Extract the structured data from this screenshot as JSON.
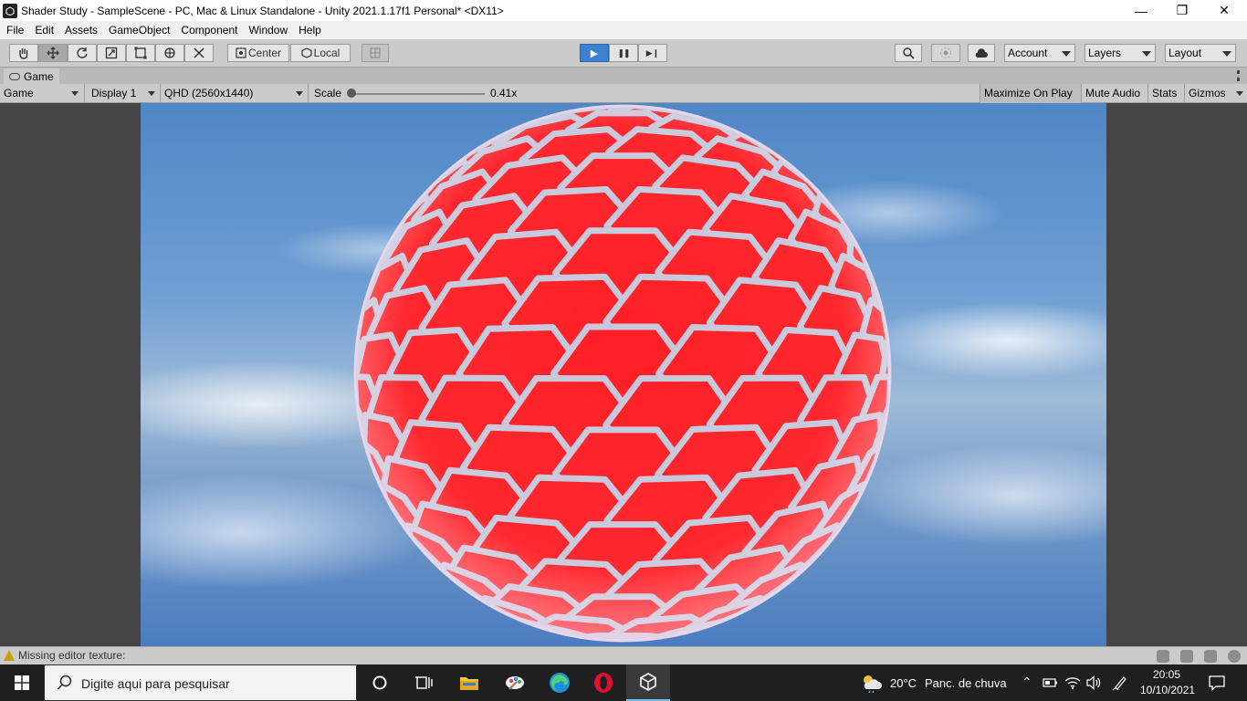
{
  "window": {
    "title": "Shader Study - SampleScene - PC, Mac & Linux Standalone - Unity 2021.1.17f1 Personal* <DX11>",
    "controls": {
      "minimize": "—",
      "maximize": "❐",
      "close": "✕"
    }
  },
  "menu": [
    "File",
    "Edit",
    "Assets",
    "GameObject",
    "Component",
    "Window",
    "Help"
  ],
  "toolbar": {
    "tools": [
      "hand-tool-icon",
      "move-tool-icon",
      "rotate-tool-icon",
      "scale-tool-icon",
      "rect-tool-icon",
      "transform-tool-icon",
      "custom-tool-icon"
    ],
    "pivot_label": "Center",
    "space_label": "Local",
    "play_icon": "▶",
    "pause_icon": "❚❚",
    "step_icon": "▶❙",
    "account_label": "Account",
    "layers_label": "Layers",
    "layout_label": "Layout"
  },
  "tab": {
    "label": "Game"
  },
  "gamebar": {
    "view_label": "Game",
    "display_label": "Display 1",
    "resolution_label": "QHD (2560x1440)",
    "scale_label": "Scale",
    "scale_value": "0.41x",
    "maximize_label": "Maximize On Play",
    "mute_label": "Mute Audio",
    "stats_label": "Stats",
    "gizmos_label": "Gizmos"
  },
  "status": {
    "message": "Missing editor texture:"
  },
  "taskbar": {
    "search_placeholder": "Digite aqui para pesquisar",
    "weather_temp": "20°C",
    "weather_desc": "Panc. de chuva",
    "time": "20:05",
    "date": "10/10/2021"
  },
  "colors": {
    "hex_fill": "#ff1f26",
    "hex_border": "#c8c8dc",
    "sky": "#5d8fcb",
    "play_active": "#3d7fd1"
  }
}
